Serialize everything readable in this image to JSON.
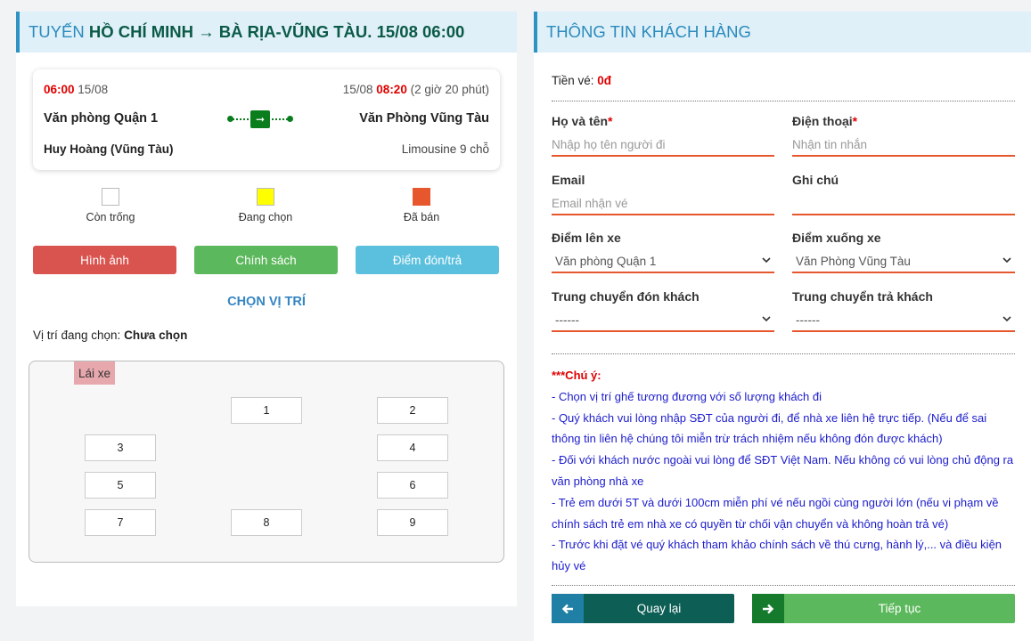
{
  "route": {
    "prefix": "TUYẾN",
    "name": "HỒ CHÍ MINH → BÀ RỊA-VŨNG TÀU.",
    "date_time": "15/08 06:00"
  },
  "trip": {
    "depart_time": "06:00",
    "depart_date": "15/08",
    "arrive_date": "15/08",
    "arrive_time": "08:20",
    "duration": "(2 giờ 20 phút)",
    "from_office": "Văn phòng Quận 1",
    "to_office": "Văn Phòng Vũng Tàu",
    "operator": "Huy Hoàng (Vũng Tàu)",
    "vehicle": "Limousine 9 chỗ"
  },
  "legend": [
    {
      "label": "Còn trống",
      "color": "#ffffff"
    },
    {
      "label": "Đang chọn",
      "color": "#ffff00"
    },
    {
      "label": "Đã bán",
      "color": "#e6572e"
    }
  ],
  "actions": {
    "images": "Hình ảnh",
    "policy": "Chính sách",
    "pickup": "Điểm đón/trả"
  },
  "seat_section": {
    "title": "CHỌN VỊ TRÍ",
    "selected_label": "Vị trí đang chọn:",
    "selected_value": "Chưa chọn",
    "driver": "Lái xe",
    "seats": [
      "1",
      "2",
      "3",
      "4",
      "5",
      "6",
      "7",
      "8",
      "9"
    ]
  },
  "customer": {
    "title": "THÔNG TIN KHÁCH HÀNG",
    "fee_label": "Tiền vé:",
    "fee_value": "0đ",
    "name_label": "Họ và tên",
    "name_placeholder": "Nhập họ tên người đi",
    "phone_label": "Điện thoại",
    "phone_placeholder": "Nhận tin nhắn",
    "email_label": "Email",
    "email_placeholder": "Email nhận vé",
    "note_label": "Ghi chú",
    "note_value": "",
    "pickup_label": "Điểm lên xe",
    "pickup_value": "Văn phòng Quận 1",
    "dropoff_label": "Điểm xuống xe",
    "dropoff_value": "Văn Phòng Vũng Tàu",
    "transfer_pickup_label": "Trung chuyển đón khách",
    "transfer_pickup_value": "------",
    "transfer_drop_label": "Trung chuyển trả khách",
    "transfer_drop_value": "------",
    "required_mark": "*"
  },
  "notice": {
    "title": "***Chú ý:",
    "lines": [
      "- Chọn vị trí ghế tương đương với số lượng khách đi",
      "- Quý khách vui lòng nhập SĐT của người đi, để nhà xe liên hệ trực tiếp. (Nếu để sai thông tin liên hệ chúng tôi miễn trừ trách nhiệm nếu không đón được khách)",
      "- Đối với khách nước ngoài vui lòng để SĐT Việt Nam. Nếu không có vui lòng chủ động ra văn phòng nhà xe",
      "- Trẻ em dưới 5T và dưới 100cm miễn phí vé nếu ngồi cùng người lớn (nếu vi phạm về chính sách trẻ em nhà xe có quyền từ chối vận chuyển và không hoàn trả vé)",
      "- Trước khi đặt vé quý khách tham khảo chính sách về thú cưng, hành lý,... và điều kiện hủy vé"
    ]
  },
  "nav": {
    "back": "Quay lại",
    "next": "Tiếp tục"
  },
  "colors": {
    "accent": "#2e93c2",
    "title_green": "#0b5a47",
    "danger": "#d9534f",
    "success": "#5cb85c",
    "info": "#5bc0de",
    "underline": "#e6572e",
    "notice_blue": "#1c1ccc"
  }
}
